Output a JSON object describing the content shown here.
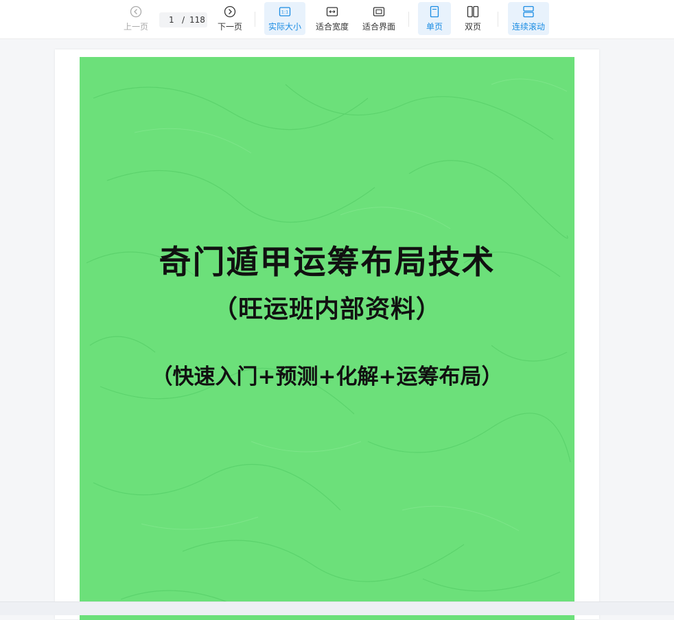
{
  "toolbar": {
    "prev": "上一页",
    "next": "下一页",
    "page_current": "1",
    "page_separator": "/",
    "page_total": "118",
    "actual_size": "实际大小",
    "fit_width": "适合宽度",
    "fit_screen": "适合界面",
    "single_page": "单页",
    "double_page": "双页",
    "continuous_scroll": "连续滚动",
    "actual_size_glyph": "1:1"
  },
  "document": {
    "title": "奇门遁甲运筹布局技术",
    "subtitle": "（旺运班内部资料）",
    "tagline": "（快速入门+预测+化解+运筹布局）"
  },
  "colors": {
    "accent": "#1a8ce3",
    "active_bg": "#e8f2fc",
    "cover_green": "#6ce07a"
  }
}
